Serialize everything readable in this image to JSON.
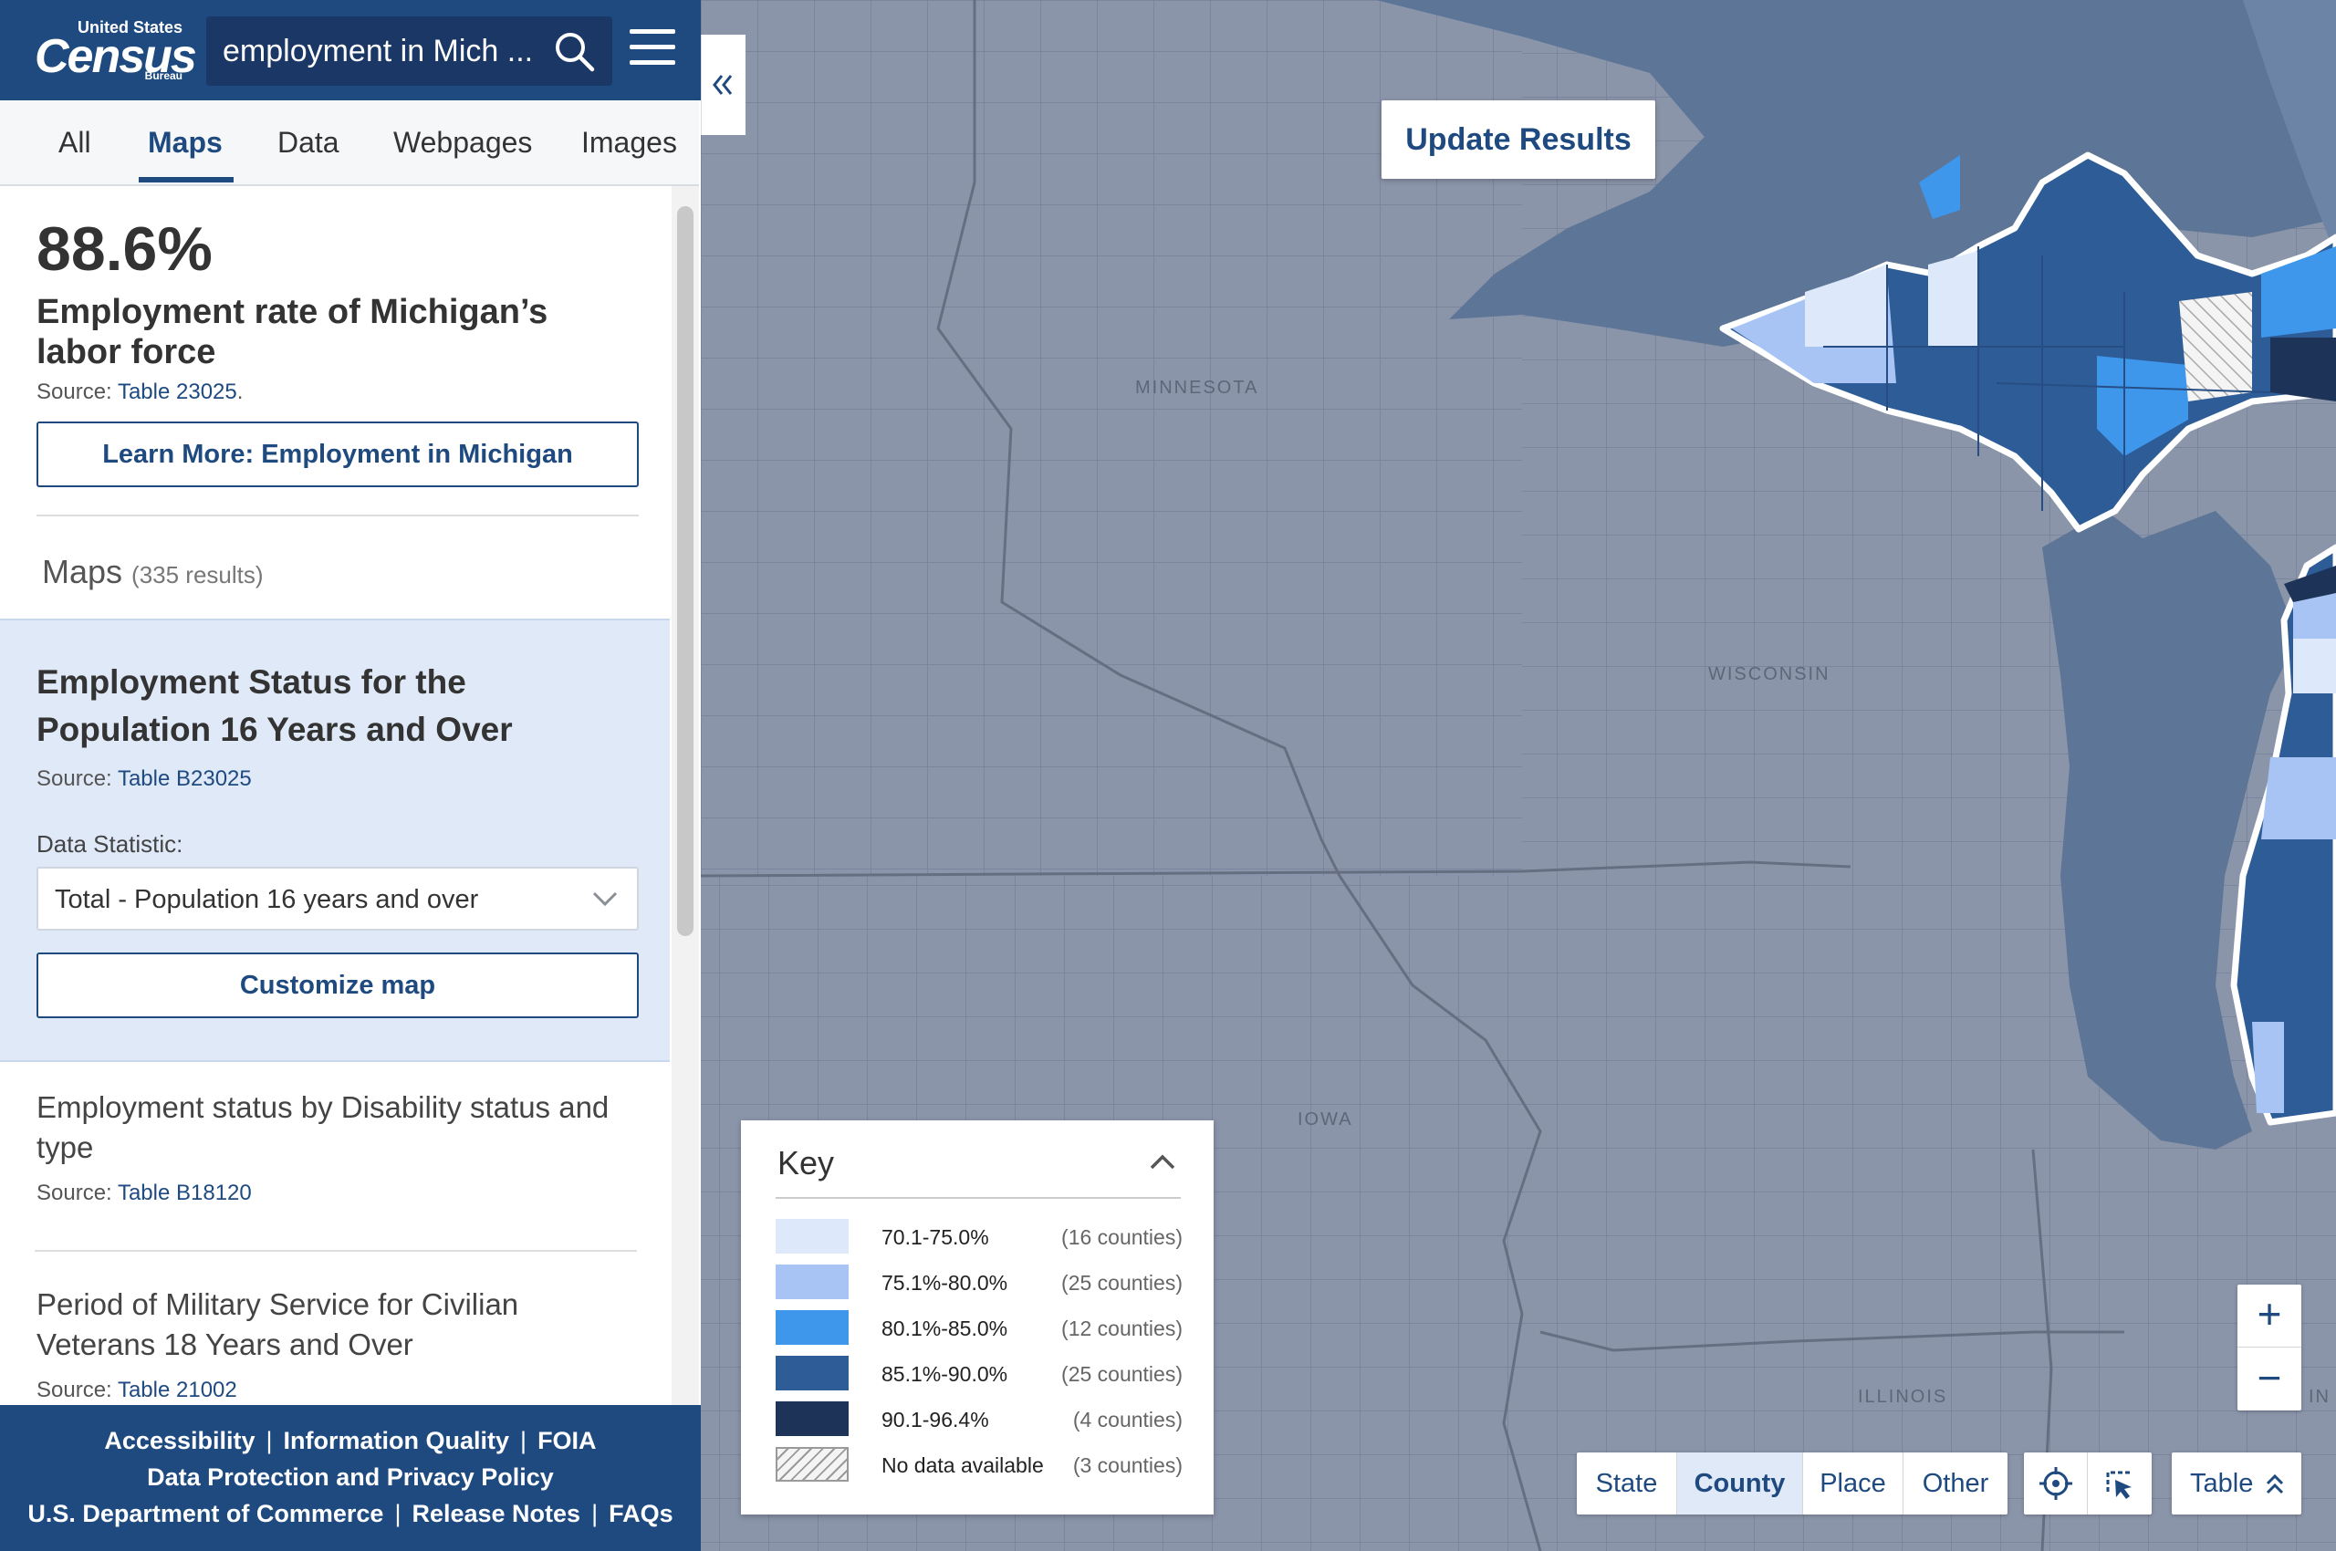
{
  "header": {
    "logo": {
      "top": "United States",
      "main": "Census",
      "bottom": "Bureau"
    },
    "search_value": "employment in Mich ...",
    "search_icon": "search-icon",
    "menu_icon": "hamburger-menu-icon"
  },
  "tabs": [
    {
      "label": "All"
    },
    {
      "label": "Maps",
      "active": true
    },
    {
      "label": "Data"
    },
    {
      "label": "Webpages"
    },
    {
      "label": "Images"
    }
  ],
  "stat": {
    "value": "88.6%",
    "title": "Employment rate of Michigan’s labor force",
    "source_prefix": "Source:",
    "source_link": "Table 23025",
    "source_suffix": ".",
    "learn_more": "Learn More: Employment in Michigan"
  },
  "maps_section": {
    "heading": "Maps",
    "count": "(335 results)"
  },
  "selected_card": {
    "title": "Employment Status for the Population 16 Years and Over",
    "source_prefix": "Source:",
    "source_link": "Table B23025",
    "statistic_label": "Data Statistic:",
    "statistic_value": "Total - Population 16 years and over",
    "customize": "Customize map"
  },
  "results": [
    {
      "title": "Employment status by Disability status and type",
      "source_prefix": "Source:",
      "source_link": "Table B18120"
    },
    {
      "title": "Period of Military Service for Civilian Veterans 18 Years and Over",
      "source_prefix": "Source:",
      "source_link": "Table 21002"
    }
  ],
  "footer": {
    "accessibility": "Accessibility",
    "info_quality": "Information Quality",
    "foia": "FOIA",
    "privacy": "Data Protection and Privacy Policy",
    "commerce": "U.S. Department of Commerce",
    "release_notes": "Release Notes",
    "faqs": "FAQs",
    "sep": "|"
  },
  "map": {
    "update_button": "Update Results",
    "state_labels": {
      "minnesota": "MINNESOTA",
      "wisconsin": "WISCONSIN",
      "iowa": "IOWA",
      "illinois": "ILLINOIS",
      "indiana": "IN"
    },
    "colors": {
      "water": "#5d7596",
      "land": "#8b95a9",
      "border": "#6d7789",
      "michigan_outline": "#ffffff"
    }
  },
  "key": {
    "title": "Key",
    "items": [
      {
        "label": "70.1-75.0%",
        "count": "(16 counties)",
        "color": "#dde8fb"
      },
      {
        "label": "75.1%-80.0%",
        "count": "(25 counties)",
        "color": "#a7c4f4"
      },
      {
        "label": "80.1%-85.0%",
        "count": "(12 counties)",
        "color": "#3f97ec"
      },
      {
        "label": "85.1%-90.0%",
        "count": "(25 counties)",
        "color": "#2d5c97"
      },
      {
        "label": "90.1-96.4%",
        "count": "(4 counties)",
        "color": "#1d3358"
      },
      {
        "label": "No data available",
        "count": "(3 counties)",
        "color": "hatched"
      }
    ]
  },
  "geo_levels": [
    {
      "label": "State"
    },
    {
      "label": "County",
      "active": true
    },
    {
      "label": "Place"
    },
    {
      "label": "Other"
    }
  ],
  "tools": [
    "locate-icon",
    "select-area-icon"
  ],
  "table_button": "Table",
  "zoom": {
    "in": "+",
    "out": "−"
  }
}
